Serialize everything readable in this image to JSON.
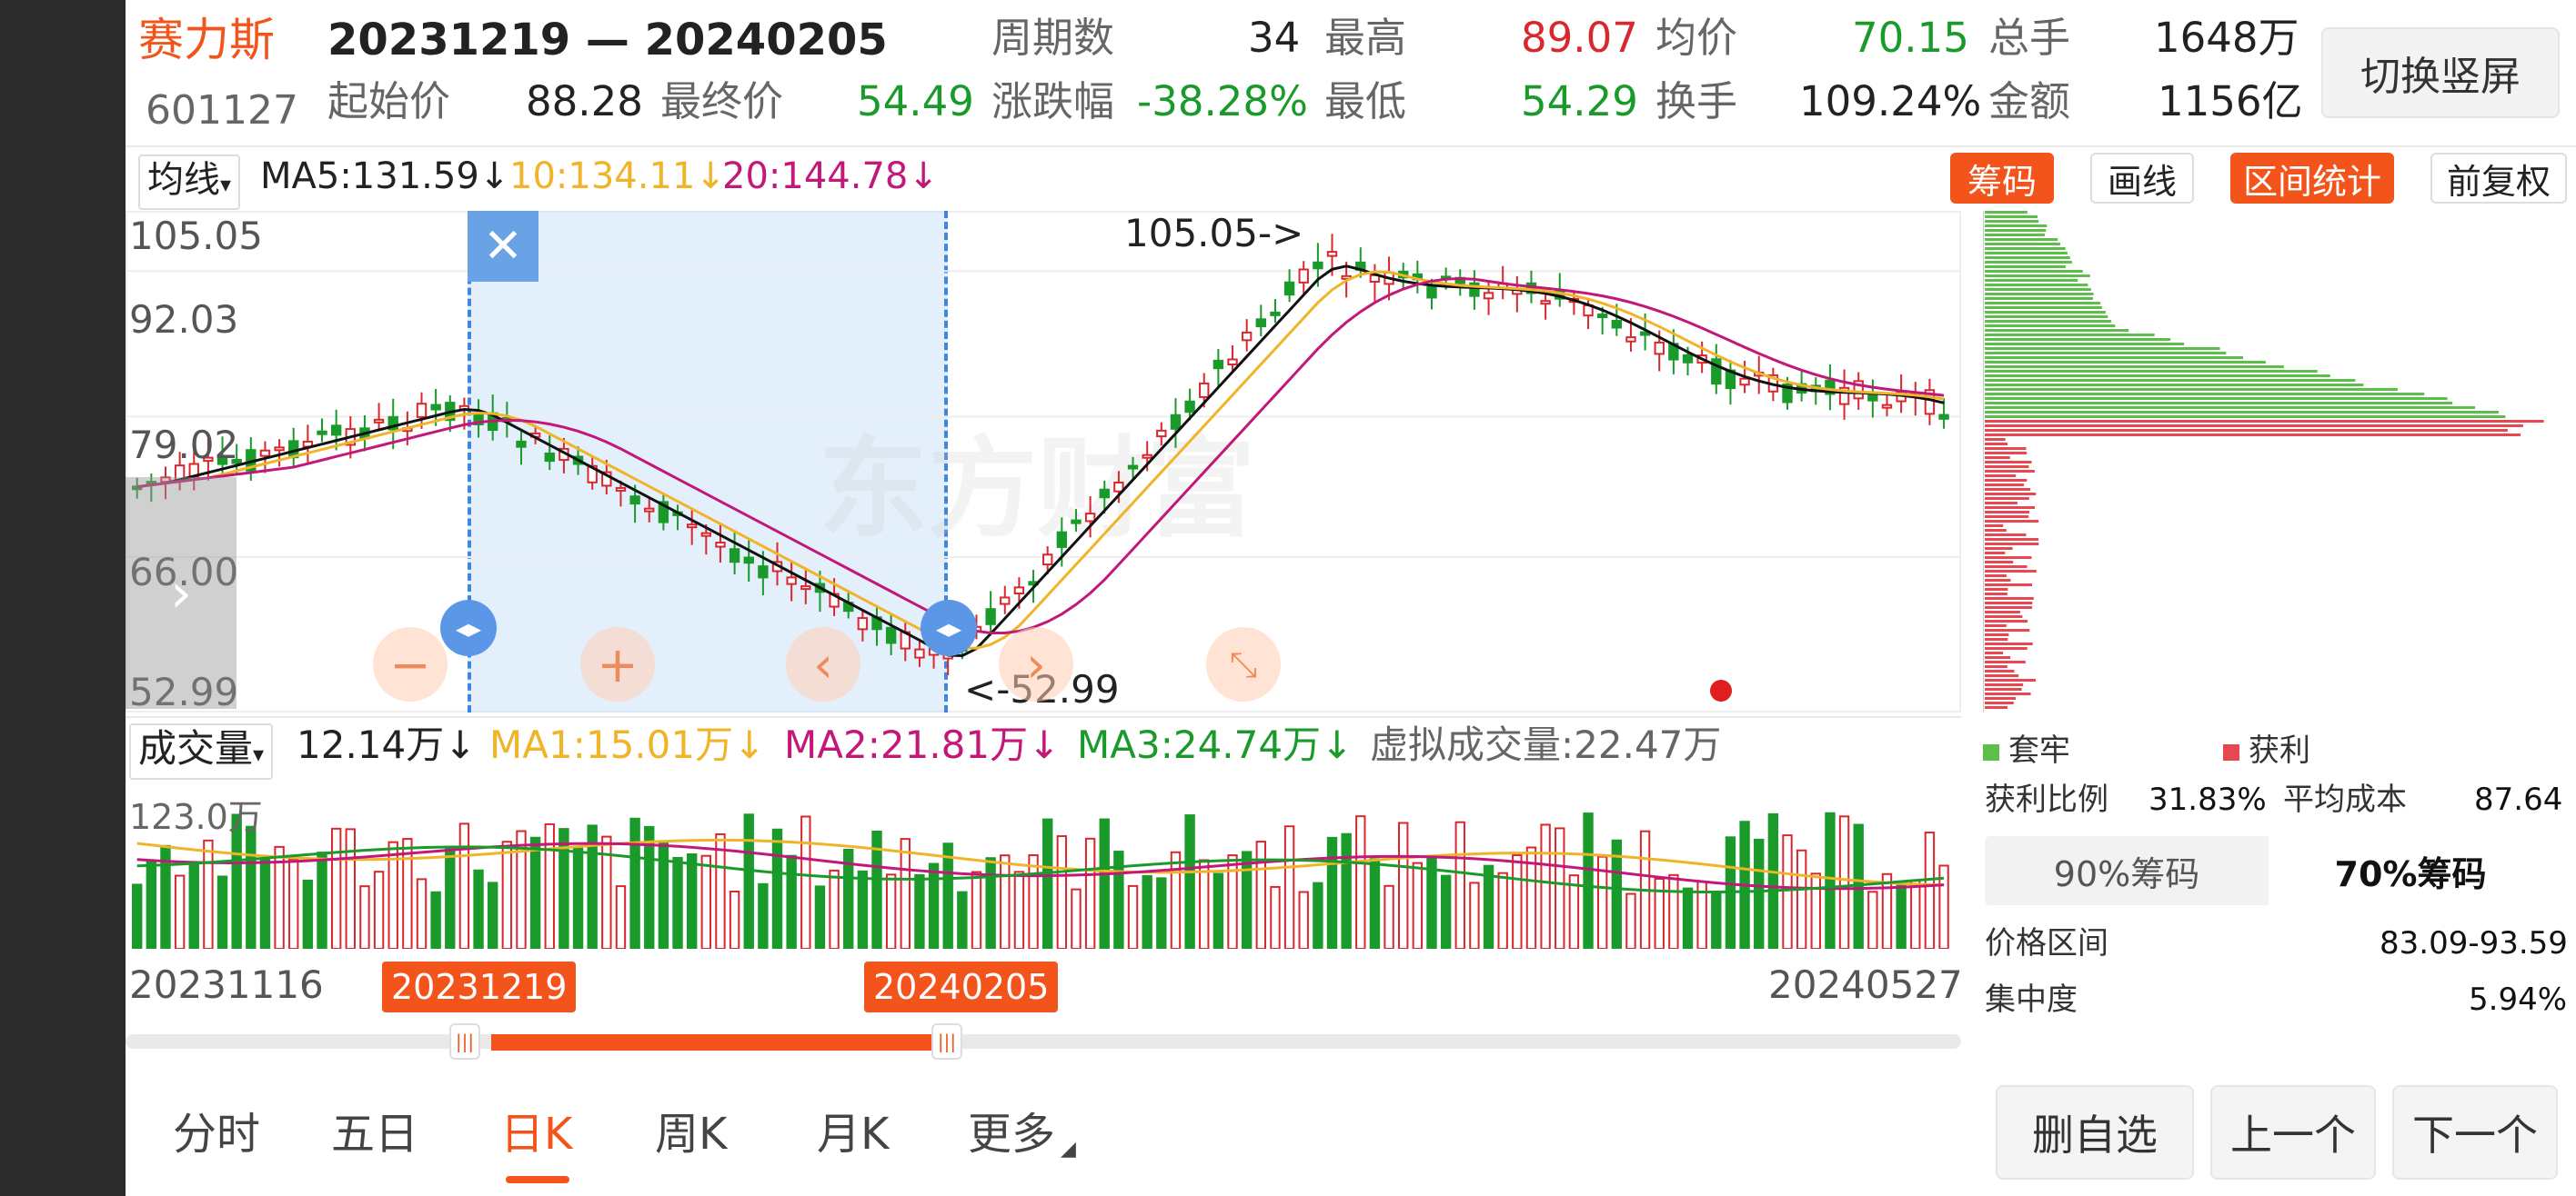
{
  "header": {
    "stock_name": "赛力斯",
    "stock_code": "601127",
    "date_range": "20231219 — 20240205",
    "labels": {
      "start_price": "起始价",
      "end_price": "最终价",
      "periods": "周期数",
      "change_pct": "涨跌幅",
      "high": "最高",
      "low": "最低",
      "avg_price": "均价",
      "turnover": "换手",
      "total_volume": "总手",
      "amount": "金额"
    },
    "values": {
      "start_price": "88.28",
      "end_price": "54.49",
      "periods": "34",
      "change_pct": "-38.28%",
      "high": "89.07",
      "low": "54.29",
      "avg_price": "70.15",
      "turnover": "109.24%",
      "total_volume": "1648万",
      "amount": "1156亿"
    },
    "switch_button": "切换竖屏"
  },
  "ma_bar": {
    "selector": "均线",
    "ma5": "MA5:131.59↓",
    "ma10": "10:134.11↓",
    "ma20": "20:144.78↓",
    "tools": {
      "chips": "筹码",
      "draw": "画线",
      "range_stats": "区间统计",
      "adjust": "前复权"
    }
  },
  "price_axis": [
    "105.05",
    "92.03",
    "79.02",
    "66.00",
    "52.99"
  ],
  "annotations": {
    "high_marker": "105.05->",
    "low_marker": "<-52.99"
  },
  "watermark": "东方财富",
  "volume_bar": {
    "selector": "成交量",
    "current": "12.14万↓",
    "ma1": "MA1:15.01万↓",
    "ma2": "MA2:21.81万↓",
    "ma3": "MA3:24.74万↓",
    "virtual": "虚拟成交量:22.47万",
    "axis_max": "123.0万"
  },
  "timeline": {
    "start": "20231116",
    "end": "20240527",
    "range_start": "20231219",
    "range_end": "20240205"
  },
  "chips": {
    "legend_trapped": "套牢",
    "legend_profit": "获利",
    "profit_ratio_label": "获利比例",
    "profit_ratio": "31.83%",
    "avg_cost_label": "平均成本",
    "avg_cost": "87.64",
    "tab_90": "90%筹码",
    "tab_70": "70%筹码",
    "price_range_label": "价格区间",
    "price_range": "83.09-93.59",
    "concentration_label": "集中度",
    "concentration": "5.94%"
  },
  "period_tabs": [
    "分时",
    "五日",
    "日K",
    "周K",
    "月K",
    "更多"
  ],
  "active_tab": "日K",
  "bottom_buttons": {
    "remove": "删自选",
    "prev": "上一个",
    "next": "下一个"
  },
  "colors": {
    "up": "#d9272e",
    "down": "#1a9a2a",
    "accent": "#f2541b",
    "ma5": "#111111",
    "ma10": "#f0b429",
    "ma20": "#c2187a",
    "chip_profit": "#e8474f",
    "chip_trapped": "#5cbf4a"
  }
}
